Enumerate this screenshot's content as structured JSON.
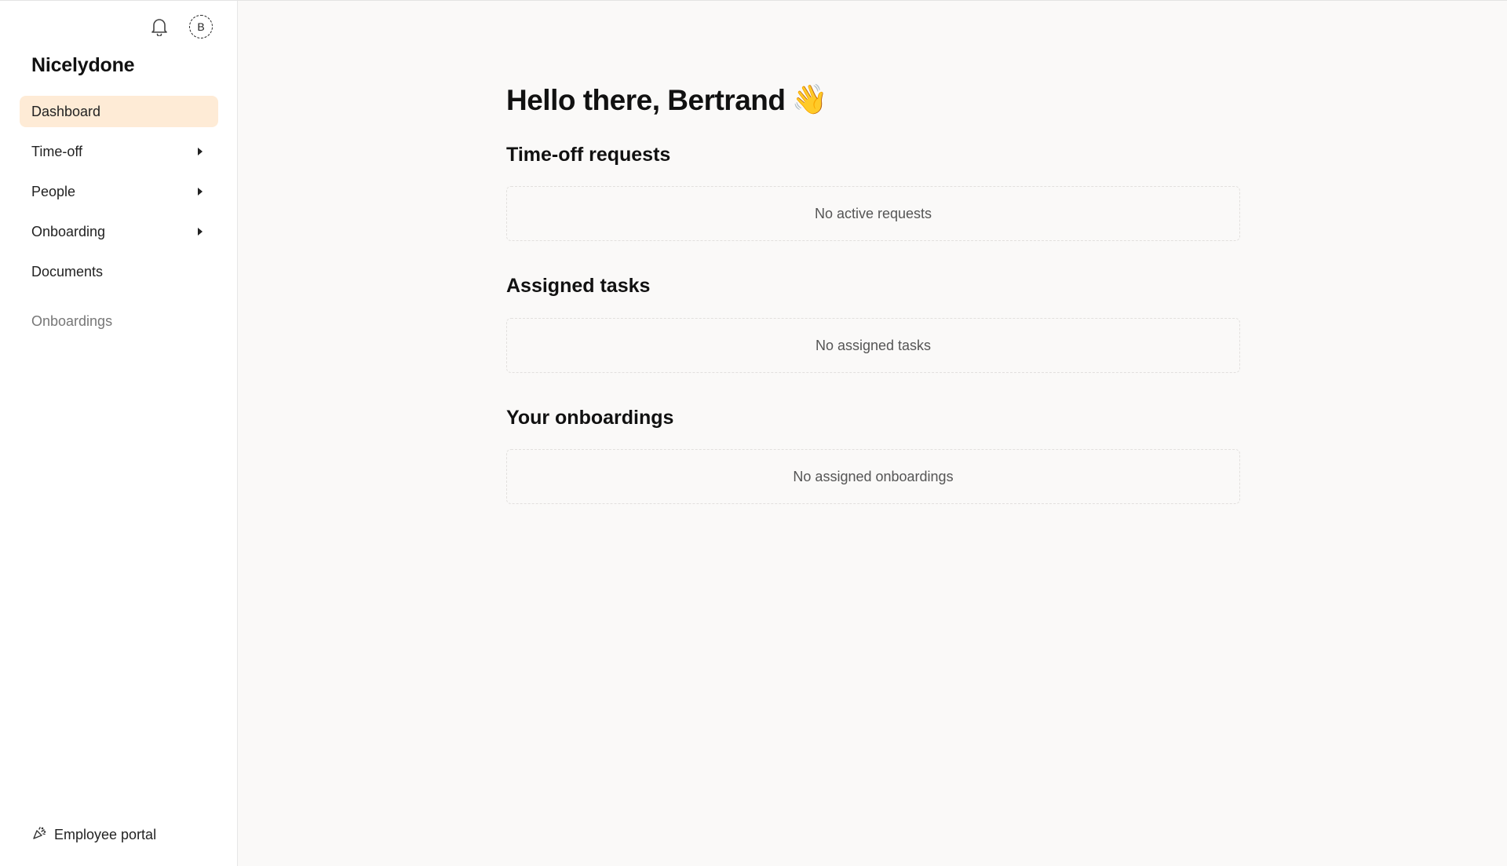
{
  "app": {
    "brand": "Nicelydone",
    "avatar_initial": "B"
  },
  "sidebar": {
    "items": [
      {
        "label": "Dashboard",
        "active": true,
        "has_submenu": false
      },
      {
        "label": "Time-off",
        "active": false,
        "has_submenu": true
      },
      {
        "label": "People",
        "active": false,
        "has_submenu": true
      },
      {
        "label": "Onboarding",
        "active": false,
        "has_submenu": true
      },
      {
        "label": "Documents",
        "active": false,
        "has_submenu": false
      }
    ],
    "section_label": "Onboardings",
    "footer_link": "Employee portal"
  },
  "main": {
    "greeting": "Hello there, Bertrand",
    "greeting_emoji": "👋",
    "sections": [
      {
        "title": "Time-off requests",
        "empty_text": "No active requests"
      },
      {
        "title": "Assigned tasks",
        "empty_text": "No assigned tasks"
      },
      {
        "title": "Your onboardings",
        "empty_text": "No assigned onboardings"
      }
    ]
  },
  "icons": {
    "notifications": "bell-icon",
    "portal": "party-popper-icon",
    "submenu": "caret-right-icon"
  },
  "colors": {
    "active_nav_bg": "#feebd6",
    "page_bg": "#faf9f8",
    "sidebar_bg": "#ffffff"
  }
}
